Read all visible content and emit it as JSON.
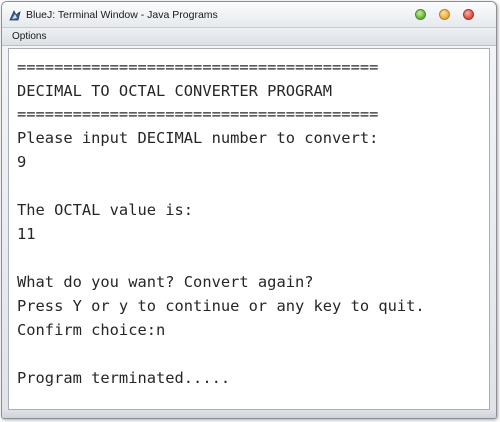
{
  "window": {
    "title": "BlueJ: Terminal Window - Java Programs"
  },
  "menubar": {
    "options_label": "Options"
  },
  "terminal": {
    "lines": [
      "=======================================",
      "DECIMAL TO OCTAL CONVERTER PROGRAM",
      "=======================================",
      "Please input DECIMAL number to convert:",
      "9",
      "",
      "The OCTAL value is:",
      "11",
      "",
      "What do you want? Convert again?",
      "Press Y or y to continue or any key to quit.",
      "Confirm choice:n",
      "",
      "Program terminated....."
    ]
  },
  "colors": {
    "window_button_minimize": "#5fae2e",
    "window_button_maximize": "#e9a43a",
    "window_button_close": "#d9473a",
    "terminal_text": "#262626",
    "terminal_background": "#ffffff"
  },
  "icons": {
    "app": "bluej-app-icon",
    "minimize": "minimize-icon",
    "maximize": "maximize-icon",
    "close": "close-icon"
  }
}
